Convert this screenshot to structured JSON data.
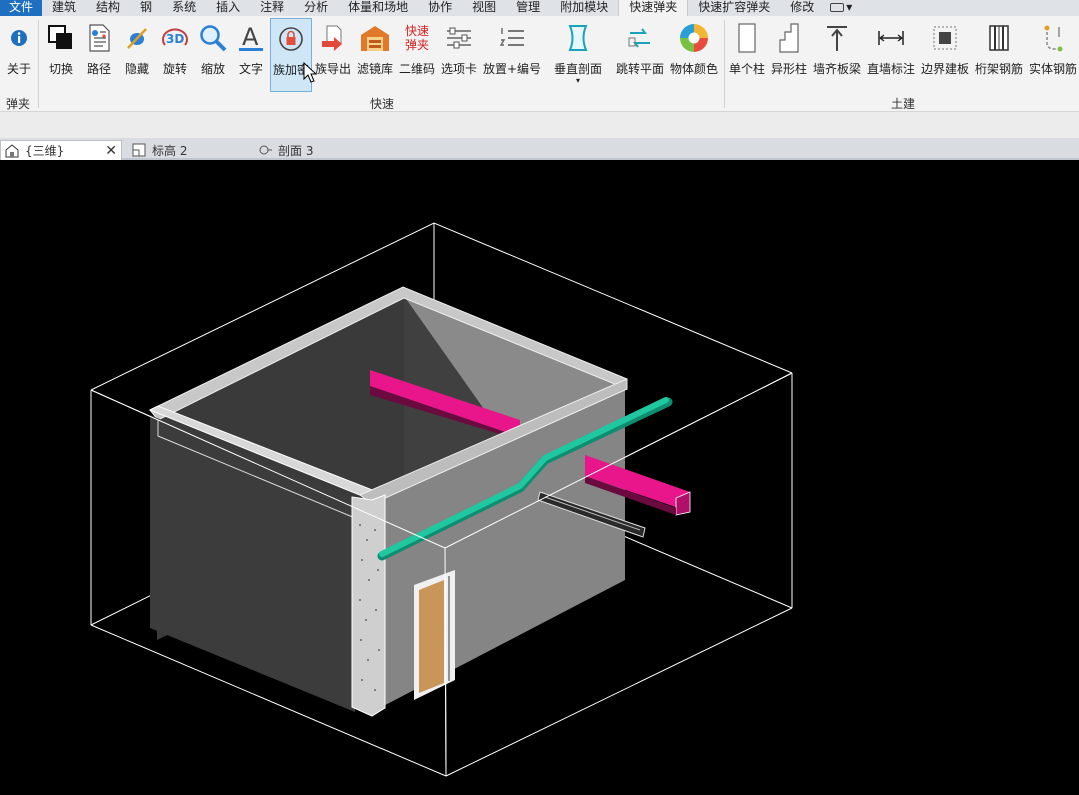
{
  "menu": {
    "tabs": [
      "文件",
      "建筑",
      "结构",
      "钢",
      "系统",
      "插入",
      "注释",
      "分析",
      "体量和场地",
      "协作",
      "视图",
      "管理",
      "附加模块",
      "快速弹夹",
      "快速扩容弹夹",
      "修改"
    ]
  },
  "ribbon": {
    "about": "关于",
    "group_danjia": "弹夹",
    "group_kuaisu": "快速",
    "group_tujian": "土建",
    "buttons": {
      "qiehuan": "切换",
      "lujing": "路径",
      "yincang": "隐藏",
      "xuanzhuan": "旋转",
      "suofang": "缩放",
      "wenzi": "文字",
      "zujiami": "族加密",
      "zudaochu": "族导出",
      "lvjingku": "滤镜库",
      "erweima": "二维码",
      "xuanxiangka": "选项卡",
      "fangzhibianhao": "放置+编号",
      "chuizhipoumian": "垂直剖面",
      "tiaozhuanpingmian": "跳转平面",
      "wutiyanse": "物体颜色",
      "dangezhu": "单个柱",
      "yixingzhu": "异形柱",
      "qiangqibanliang": "墙齐板梁",
      "zhiqiangbiaozhu": "直墙标注",
      "bianjiejianban": "边界建板",
      "hengjiagangjin": "桁架钢筋",
      "shitigangjin": "实体钢筋"
    },
    "icon_text": {
      "threed": "3D",
      "kuaisu_line1": "快速",
      "kuaisu_line2": "弹夹",
      "wenzi_glyph": "A"
    }
  },
  "viewtabs": [
    {
      "label": "{三维}",
      "active": true
    },
    {
      "label": "标高 2",
      "active": false
    },
    {
      "label": "剖面 3",
      "active": false
    }
  ],
  "colors": {
    "pipe": "#1fc8a0",
    "beam": "#e8168a",
    "door": "#c9965a",
    "ribbon_bg": "#f3f3f3",
    "selected_bg": "#cfe6f7"
  }
}
